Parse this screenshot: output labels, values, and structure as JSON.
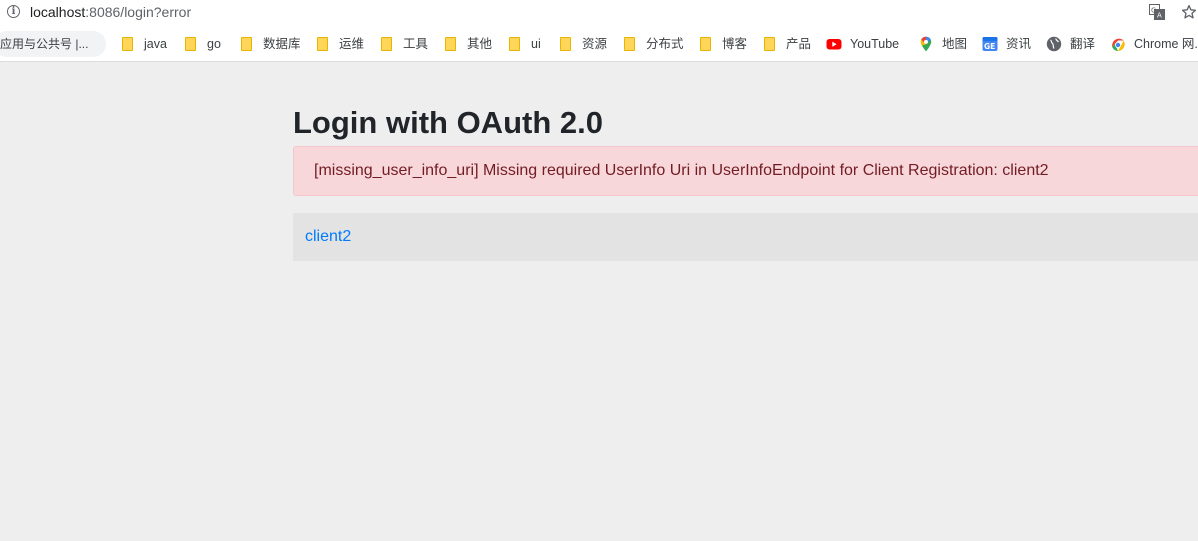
{
  "browser": {
    "url_host": "localhost",
    "url_path": ":8086/login?error",
    "info_icon_glyph": "i",
    "bookmarks_bar": {
      "first_item": "应用与公共号 |...",
      "items": [
        {
          "label": "java",
          "icon": "folder-icon"
        },
        {
          "label": "go",
          "icon": "folder-icon"
        },
        {
          "label": "数据库",
          "icon": "folder-icon"
        },
        {
          "label": "运维",
          "icon": "folder-icon"
        },
        {
          "label": "工具",
          "icon": "folder-icon"
        },
        {
          "label": "其他",
          "icon": "folder-icon"
        },
        {
          "label": "ui",
          "icon": "folder-icon"
        },
        {
          "label": "资源",
          "icon": "folder-icon"
        },
        {
          "label": "分布式",
          "icon": "folder-icon"
        },
        {
          "label": "博客",
          "icon": "folder-icon"
        },
        {
          "label": "产品",
          "icon": "folder-icon"
        },
        {
          "label": "YouTube",
          "icon": "youtube-icon"
        },
        {
          "label": "地图",
          "icon": "maps-pin-icon"
        },
        {
          "label": "资讯",
          "icon": "news-icon"
        },
        {
          "label": "翻译",
          "icon": "globe-icon"
        },
        {
          "label": "Chrome 网...",
          "icon": "chrome-icon"
        }
      ]
    }
  },
  "page": {
    "title": "Login with OAuth 2.0",
    "error_message": "[missing_user_info_uri] Missing required UserInfo Uri in UserInfoEndpoint for Client Registration: client2",
    "clients": [
      {
        "label": "client2"
      }
    ]
  },
  "colors": {
    "page_background": "#eeeeee",
    "alert_background": "#f8d7da",
    "alert_text": "#721c24",
    "link": "#007bff",
    "client_row_background": "#e3e3e3"
  }
}
